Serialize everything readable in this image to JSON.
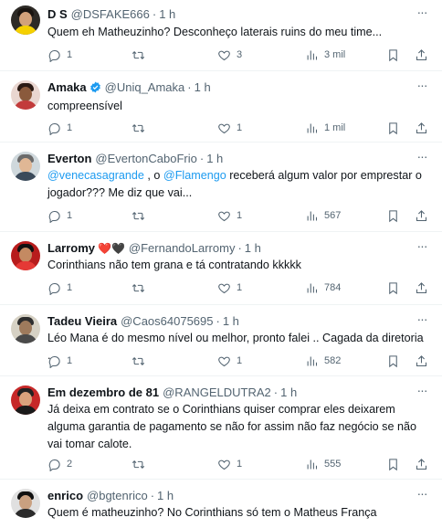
{
  "more_label": "···",
  "colors": {
    "text": "#0f1419",
    "muted": "#536471",
    "link": "#1d9bf0",
    "verified": "#1d9bf0",
    "divider": "#eff3f4"
  },
  "tweets": [
    {
      "name": "D S",
      "handle": "@DSFAKE666",
      "dot": "·",
      "time": "1 h",
      "text": "Quem eh Matheuzinho? Desconheço laterais ruins do meu time...",
      "replies": "1",
      "retweets": "",
      "likes": "3",
      "views": "3 mil"
    },
    {
      "name": "Amaka",
      "verified": true,
      "handle": "@Uniq_Amaka",
      "dot": "·",
      "time": "1 h",
      "text": "compreensível",
      "replies": "1",
      "retweets": "",
      "likes": "1",
      "views": "1 mil"
    },
    {
      "name": "Everton",
      "handle": "@EvertonCaboFrio",
      "dot": "·",
      "time": "1 h",
      "mention1": "@venecasagrande",
      "text_a": " , o ",
      "mention2": "@Flamengo",
      "text_b": " receberá algum valor por emprestar o jogador??? Me diz que vai...",
      "replies": "1",
      "retweets": "",
      "likes": "1",
      "views": "567"
    },
    {
      "name": "Larromy",
      "hearts": "❤️🖤",
      "handle": "@FernandoLarromy",
      "dot": "·",
      "time": "1 h",
      "text": "Corinthians não tem grana e tá contratando kkkkk",
      "replies": "1",
      "retweets": "",
      "likes": "1",
      "views": "784"
    },
    {
      "name": "Tadeu Vieira",
      "handle": "@Caos64075695",
      "dot": "·",
      "time": "1 h",
      "text": "Léo Mana é do mesmo nível ou melhor, pronto falei .. Cagada da diretoria .",
      "replies": "1",
      "retweets": "",
      "likes": "1",
      "views": "582"
    },
    {
      "name": "Em dezembro de 81",
      "handle": "@RANGELDUTRA2",
      "dot": "·",
      "time": "1 h",
      "text": "Já deixa em contrato se o Corinthians quiser comprar eles deixarem alguma garantia de pagamento se não for assim não faz negócio se não vai tomar calote.",
      "replies": "2",
      "retweets": "",
      "likes": "1",
      "views": "555"
    },
    {
      "name": "enrico",
      "handle": "@bgtenrico",
      "dot": "·",
      "time": "1 h",
      "text": "Quem é matheuzinho? No Corinthians só tem o Matheus França"
    }
  ]
}
